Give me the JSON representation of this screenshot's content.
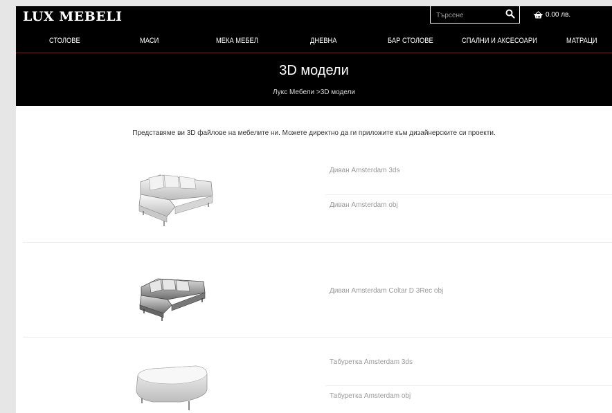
{
  "header": {
    "logo": "LUX MEBELI",
    "search_placeholder": "Търсене",
    "cart_total": "0.00 лв."
  },
  "nav": [
    {
      "label": "СТОЛОВЕ"
    },
    {
      "label": "МАСИ"
    },
    {
      "label": "МЕКА МЕБЕЛ"
    },
    {
      "label": "ДНЕВНА"
    },
    {
      "label": "БАР СТОЛОВЕ"
    },
    {
      "label": "СПАЛНИ И АКСЕСОАРИ"
    },
    {
      "label": "МАТРАЦИ"
    }
  ],
  "banner": {
    "title": "3D модели",
    "breadcrumb_home": "Лукс Мебели",
    "breadcrumb_separator": " >",
    "breadcrumb_current": "3D модели"
  },
  "intro": "Представяме ви 3D файлове на мебелите ни. Можете директно да ги приложите към дизайнерските си проекти.",
  "products": [
    {
      "image": "corner-sofa-light",
      "files": [
        "Диван Amsterdam 3ds",
        "Диван Amsterdam obj"
      ]
    },
    {
      "image": "corner-sofa-dark",
      "files": [
        "Диван Amsterdam Coltar D 3Rec obj"
      ]
    },
    {
      "image": "ottoman",
      "files": [
        "Табуретка Amsterdam 3ds",
        "Табуретка Amsterdam obj"
      ]
    }
  ]
}
